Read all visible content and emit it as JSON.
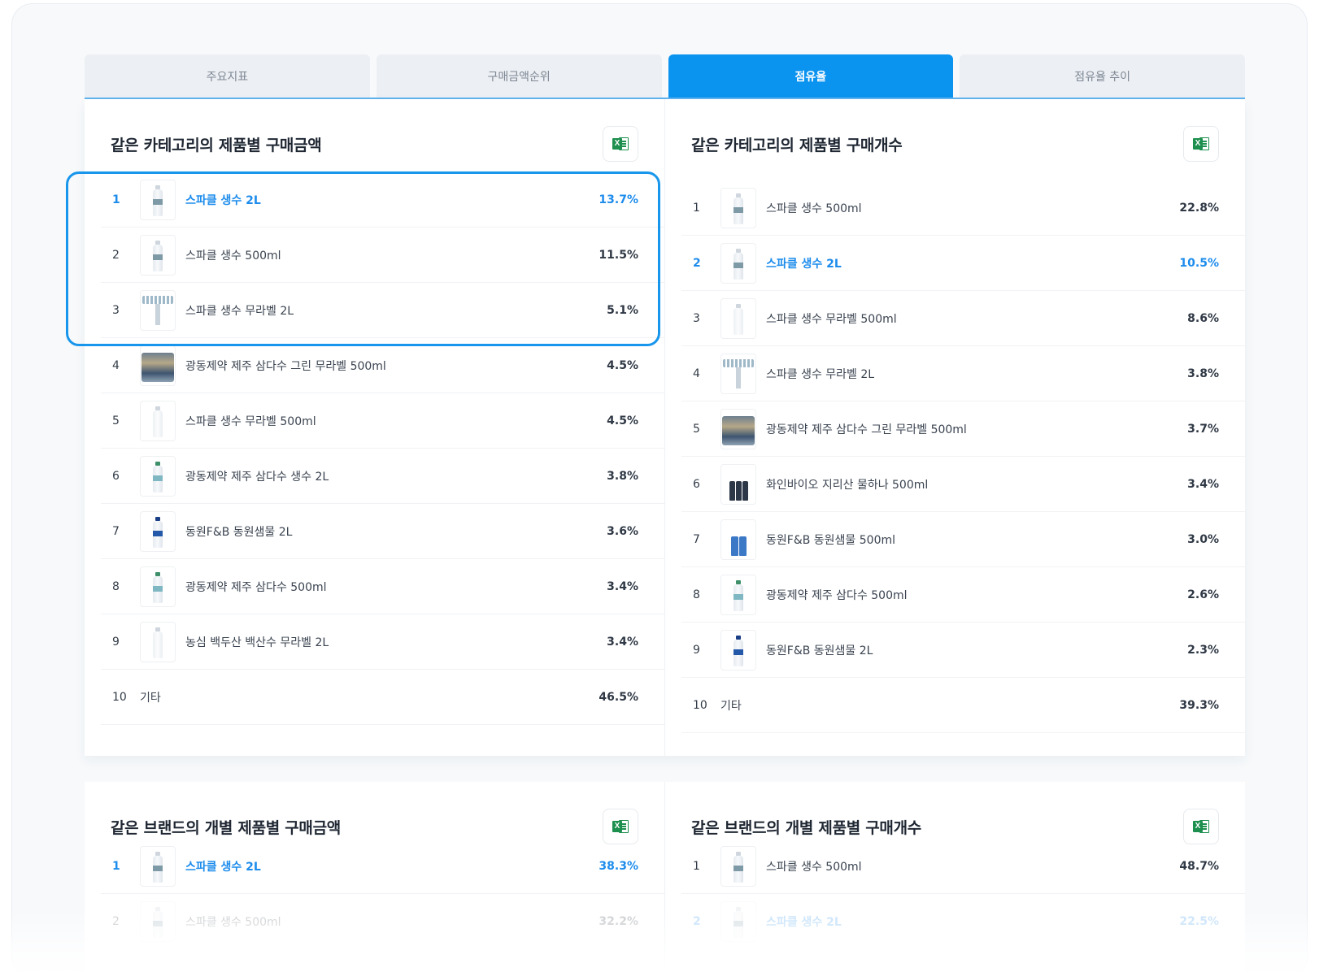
{
  "tabs": [
    {
      "label": "주요지표",
      "active": false
    },
    {
      "label": "구매금액순위",
      "active": false
    },
    {
      "label": "점유율",
      "active": true
    },
    {
      "label": "점유율 추이",
      "active": false
    }
  ],
  "colors": {
    "accent": "#0b93f0",
    "highlight_text": "#1d8cec",
    "excel_green": "#1d8f4e"
  },
  "excel_icon": {
    "letter": "X",
    "name": "excel-download-icon"
  },
  "sections": {
    "category_amount": {
      "title": "같은 카테고리의 제품별 구매금액",
      "rows": [
        {
          "rank": "1",
          "name": "스파클 생수 2L",
          "pct": "13.7%",
          "highlight": true,
          "thumb": "bottle"
        },
        {
          "rank": "2",
          "name": "스파클 생수 500ml",
          "pct": "11.5%",
          "highlight": false,
          "thumb": "bottle"
        },
        {
          "rank": "3",
          "name": "스파클 생수 무라벨 2L",
          "pct": "5.1%",
          "highlight": false,
          "thumb": "tray"
        },
        {
          "rank": "4",
          "name": "광동제약 제주 삼다수 그린 무라벨 500ml",
          "pct": "4.5%",
          "highlight": false,
          "thumb": "pack"
        },
        {
          "rank": "5",
          "name": "스파클 생수 무라벨 500ml",
          "pct": "4.5%",
          "highlight": false,
          "thumb": "clear"
        },
        {
          "rank": "6",
          "name": "광동제약 제주 삼다수 생수 2L",
          "pct": "3.8%",
          "highlight": false,
          "thumb": "green"
        },
        {
          "rank": "7",
          "name": "동원F&B 동원샘물 2L",
          "pct": "3.6%",
          "highlight": false,
          "thumb": "blue"
        },
        {
          "rank": "8",
          "name": "광동제약 제주 삼다수 500ml",
          "pct": "3.4%",
          "highlight": false,
          "thumb": "green"
        },
        {
          "rank": "9",
          "name": "농심 백두산 백산수 무라벨 2L",
          "pct": "3.4%",
          "highlight": false,
          "thumb": "clear"
        },
        {
          "rank": "10",
          "name": "기타",
          "pct": "46.5%",
          "highlight": false,
          "thumb": "none"
        }
      ]
    },
    "category_count": {
      "title": "같은 카테고리의 제품별 구매개수",
      "rows": [
        {
          "rank": "1",
          "name": "스파클 생수 500ml",
          "pct": "22.8%",
          "highlight": false,
          "thumb": "bottle"
        },
        {
          "rank": "2",
          "name": "스파클 생수 2L",
          "pct": "10.5%",
          "highlight": true,
          "thumb": "bottle"
        },
        {
          "rank": "3",
          "name": "스파클 생수 무라벨 500ml",
          "pct": "8.6%",
          "highlight": false,
          "thumb": "clear"
        },
        {
          "rank": "4",
          "name": "스파클 생수 무라벨 2L",
          "pct": "3.8%",
          "highlight": false,
          "thumb": "tray"
        },
        {
          "rank": "5",
          "name": "광동제약 제주 삼다수 그린 무라벨 500ml",
          "pct": "3.7%",
          "highlight": false,
          "thumb": "pack"
        },
        {
          "rank": "6",
          "name": "화인바이오 지리산 물하나 500ml",
          "pct": "3.4%",
          "highlight": false,
          "thumb": "multi"
        },
        {
          "rank": "7",
          "name": "동원F&B 동원샘물 500ml",
          "pct": "3.0%",
          "highlight": false,
          "thumb": "multiblue"
        },
        {
          "rank": "8",
          "name": "광동제약 제주 삼다수 500ml",
          "pct": "2.6%",
          "highlight": false,
          "thumb": "green"
        },
        {
          "rank": "9",
          "name": "동원F&B 동원샘물 2L",
          "pct": "2.3%",
          "highlight": false,
          "thumb": "blue"
        },
        {
          "rank": "10",
          "name": "기타",
          "pct": "39.3%",
          "highlight": false,
          "thumb": "none"
        }
      ]
    },
    "brand_amount": {
      "title": "같은 브랜드의 개별 제품별 구매금액",
      "rows": [
        {
          "rank": "1",
          "name": "스파클 생수 2L",
          "pct": "38.3%",
          "highlight": true,
          "thumb": "bottle"
        },
        {
          "rank": "2",
          "name": "스파클 생수 500ml",
          "pct": "32.2%",
          "highlight": false,
          "thumb": "bottle",
          "faded": true
        }
      ]
    },
    "brand_count": {
      "title": "같은 브랜드의 개별 제품별 구매개수",
      "rows": [
        {
          "rank": "1",
          "name": "스파클 생수 500ml",
          "pct": "48.7%",
          "highlight": false,
          "thumb": "bottle"
        },
        {
          "rank": "2",
          "name": "스파클 생수 2L",
          "pct": "22.5%",
          "highlight": true,
          "thumb": "bottle",
          "faded": true
        }
      ]
    }
  }
}
